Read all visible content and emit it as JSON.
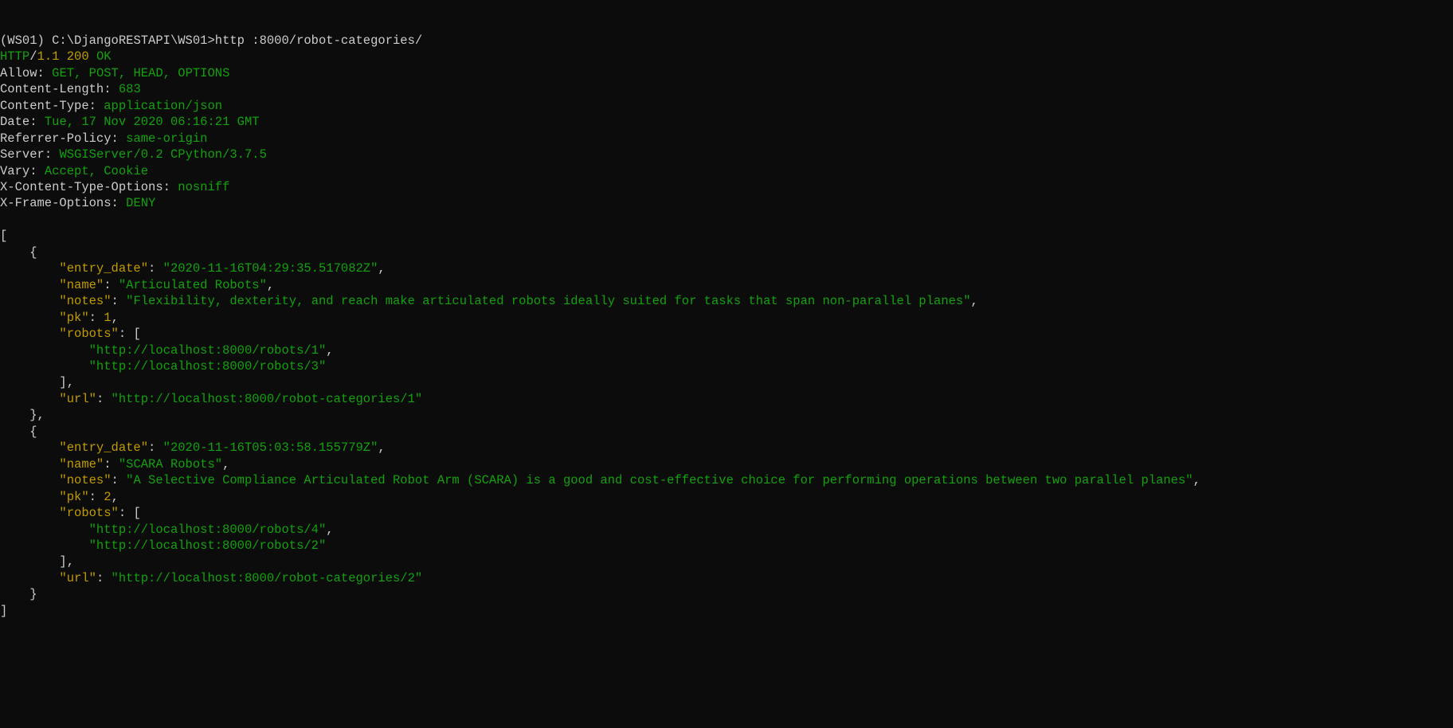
{
  "prompt": {
    "env": "(WS01) ",
    "path": "C:\\DjangoRESTAPI\\WS01>",
    "command": "http :8000/robot-categories/"
  },
  "response": {
    "proto_prefix": "HTTP",
    "proto_slash": "/",
    "proto_version": "1.1",
    "status_code": "200",
    "status_text": "OK"
  },
  "headers": [
    {
      "key": "Allow",
      "value": "GET, POST, HEAD, OPTIONS"
    },
    {
      "key": "Content-Length",
      "value": "683"
    },
    {
      "key": "Content-Type",
      "value": "application/json"
    },
    {
      "key": "Date",
      "value": "Tue, 17 Nov 2020 06:16:21 GMT"
    },
    {
      "key": "Referrer-Policy",
      "value": "same-origin"
    },
    {
      "key": "Server",
      "value": "WSGIServer/0.2 CPython/3.7.5"
    },
    {
      "key": "Vary",
      "value": "Accept, Cookie"
    },
    {
      "key": "X-Content-Type-Options",
      "value": "nosniff"
    },
    {
      "key": "X-Frame-Options",
      "value": "DENY"
    }
  ],
  "body": [
    {
      "entry_date": "\"2020-11-16T04:29:35.517082Z\"",
      "name": "\"Articulated Robots\"",
      "notes": "\"Flexibility, dexterity, and reach make articulated robots ideally suited for tasks that span non-parallel planes\"",
      "pk": "1",
      "robots": [
        "\"http://localhost:8000/robots/1\"",
        "\"http://localhost:8000/robots/3\""
      ],
      "url": "\"http://localhost:8000/robot-categories/1\""
    },
    {
      "entry_date": "\"2020-11-16T05:03:58.155779Z\"",
      "name": "\"SCARA Robots\"",
      "notes": "\"A Selective Compliance Articulated Robot Arm (SCARA) is a good and cost-effective choice for performing operations between two parallel planes\"",
      "pk": "2",
      "robots": [
        "\"http://localhost:8000/robots/4\"",
        "\"http://localhost:8000/robots/2\""
      ],
      "url": "\"http://localhost:8000/robot-categories/2\""
    }
  ]
}
